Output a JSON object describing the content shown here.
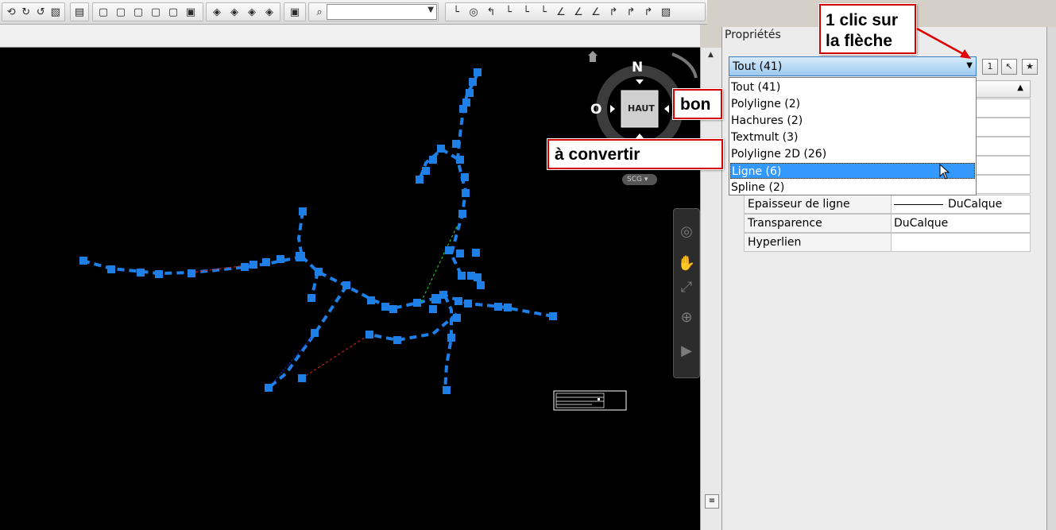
{
  "toolbar": {
    "groups": [
      {
        "icons": [
          "orbit-icon",
          "orbit-free-icon",
          "orbit-continuous-icon",
          "walk-icon"
        ]
      },
      {
        "icons": [
          "named-views-icon"
        ]
      },
      {
        "icons": [
          "view-top-icon",
          "view-bottom-icon",
          "view-left-icon",
          "view-right-icon",
          "view-front-icon",
          "view-back-icon"
        ]
      },
      {
        "icons": [
          "iso-sw-icon",
          "iso-se-icon",
          "iso-ne-icon",
          "iso-nw-icon"
        ]
      },
      {
        "icons": [
          "camera-icon"
        ]
      },
      {
        "icons": [
          "zoom-icon"
        ]
      },
      {
        "icons": [
          "ucs-icon",
          "ucs-world-icon",
          "ucs-previous-icon",
          "ucs-face-icon",
          "ucs-object-icon",
          "ucs-view-icon",
          "ucs-origin-icon",
          "ucs-zaxis-icon",
          "ucs-3point-icon",
          "ucs-x-icon",
          "ucs-y-icon",
          "ucs-z-icon",
          "ucs-apply-icon"
        ]
      }
    ],
    "view_combo_value": ""
  },
  "viewcube": {
    "north": "N",
    "west": "O",
    "face": "HAUT",
    "ucs_label": "SCG"
  },
  "properties": {
    "title": "Propriétés",
    "selection_value": "Tout (41)",
    "dropdown_items": [
      {
        "label": "Tout (41)",
        "selected": false
      },
      {
        "label": "Polyligne (2)",
        "selected": false
      },
      {
        "label": "Hachures (2)",
        "selected": false
      },
      {
        "label": "Textmult (3)",
        "selected": false
      },
      {
        "label": "Polyligne 2D (26)",
        "selected": false
      },
      {
        "label": "Ligne (6)",
        "selected": true
      },
      {
        "label": "Spline (2)",
        "selected": false
      }
    ],
    "rows": [
      {
        "label": "Epaisseur de ligne",
        "value": "DuCalque",
        "line_sample": true
      },
      {
        "label": "Transparence",
        "value": "DuCalque",
        "line_sample": false
      },
      {
        "label": "Hyperlien",
        "value": "",
        "line_sample": false
      }
    ],
    "toggle_pickadd_label": "1"
  },
  "annotations": {
    "click_arrow": "1 clic sur\nla flèche",
    "good": "bon",
    "to_convert": "à convertir"
  },
  "colors": {
    "selection_blue": "#3399ff",
    "grip_blue": "#1e7fe6",
    "annotation_red": "#d40000",
    "canvas_black": "#000000"
  }
}
